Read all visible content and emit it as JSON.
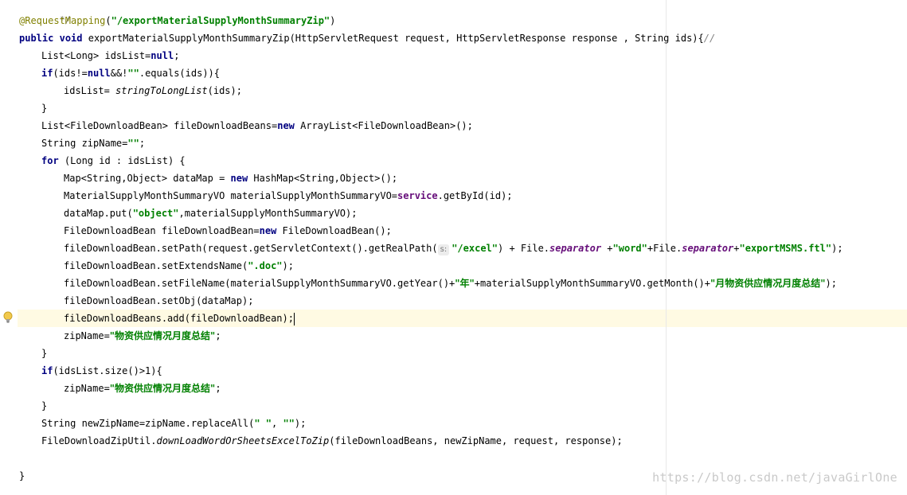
{
  "watermark": "https://blog.csdn.net/javaGirlOne",
  "hints": {
    "param_s": "s:"
  },
  "code": {
    "comment_end": " */",
    "annotation": "@RequestMapping",
    "mapping_path": "\"/exportMaterialSupplyMonthSummaryZip\"",
    "signature_rest": " exportMaterialSupplyMonthSummaryZip(HttpServletRequest request, HttpServletResponse response , String ids){",
    "signature_comment": "//",
    "l3_decl": "List<Long> idsList=",
    "l4_cond": "(ids!=",
    "l4_and": "&&!",
    "l4_empty": "\"\"",
    "l4_rest": ".equals(ids)){",
    "l5_assign": "idsList= ",
    "l5_method": "stringToLongList",
    "l5_rest": "(ids);",
    "close_brace": "}",
    "l7_decl": "List<FileDownloadBean> fileDownloadBeans=",
    "l7_rest": " ArrayList<FileDownloadBean>();",
    "l8_decl": "String zipName=",
    "l8_empty": "\"\"",
    "l9_rest": " (Long id : idsList) {",
    "l10_decl": "Map<String,Object> dataMap = ",
    "l10_rest": " HashMap<String,Object>();",
    "l11_decl": "MaterialSupplyMonthSummaryVO materialSupplyMonthSummaryVO=",
    "l11_field": "service",
    "l11_rest": ".getById(id);",
    "l12_start": "dataMap.put(",
    "l12_key": "\"object\"",
    "l12_rest": ",materialSupplyMonthSummaryVO);",
    "l13_decl": "FileDownloadBean fileDownloadBean=",
    "l13_rest": " FileDownloadBean();",
    "l14_start": "fileDownloadBean.setPath(request.getServletContext().getRealPath(",
    "l14_excel": "\"/excel\"",
    "l14_mid1": ") + File.",
    "l14_sep1": "separator",
    "l14_mid2": " +",
    "l14_word": "\"word\"",
    "l14_mid3": "+File.",
    "l14_sep2": "separator",
    "l14_mid4": "+",
    "l14_ftl": "\"exportMSMS.ftl\"",
    "l14_end": ");",
    "l15_start": "fileDownloadBean.setExtendsName(",
    "l15_doc": "\".doc\"",
    "l15_end": ");",
    "l16_start": "fileDownloadBean.setFileName(materialSupplyMonthSummaryVO.getYear()+",
    "l16_year": "\"年\"",
    "l16_mid": "+materialSupplyMonthSummaryVO.getMonth()+",
    "l16_title": "\"月物资供应情况月度总结\"",
    "l16_end": ");",
    "l17": "fileDownloadBean.setObj(dataMap);",
    "l18": "fileDownloadBeans.add(fileDownloadBean);",
    "l19_start": "zipName=",
    "l19_str": "\"物资供应情况月度总结\"",
    "l19_end": ";",
    "l21_cond": "(idsList.size()>1){",
    "l22_start": "zipName=",
    "l22_str": "\"物资供应情况月度总结\"",
    "l22_end": ";",
    "l24_start": "String newZipName=zipName.replaceAll(",
    "l24_s1": "\" \"",
    "l24_comma": ", ",
    "l24_s2": "\"\"",
    "l24_end": ");",
    "l25_start": "FileDownloadZipUtil.",
    "l25_method": "downLoadWordOrSheetsExcelToZip",
    "l25_rest": "(fileDownloadBeans, newZipName, request, response);",
    "final_brace": "}"
  },
  "keywords": {
    "public": "public",
    "void": "void",
    "null": "null",
    "if": "if",
    "new": "new",
    "for": "for",
    "semicolon": ";",
    "lparen_close": ")"
  }
}
